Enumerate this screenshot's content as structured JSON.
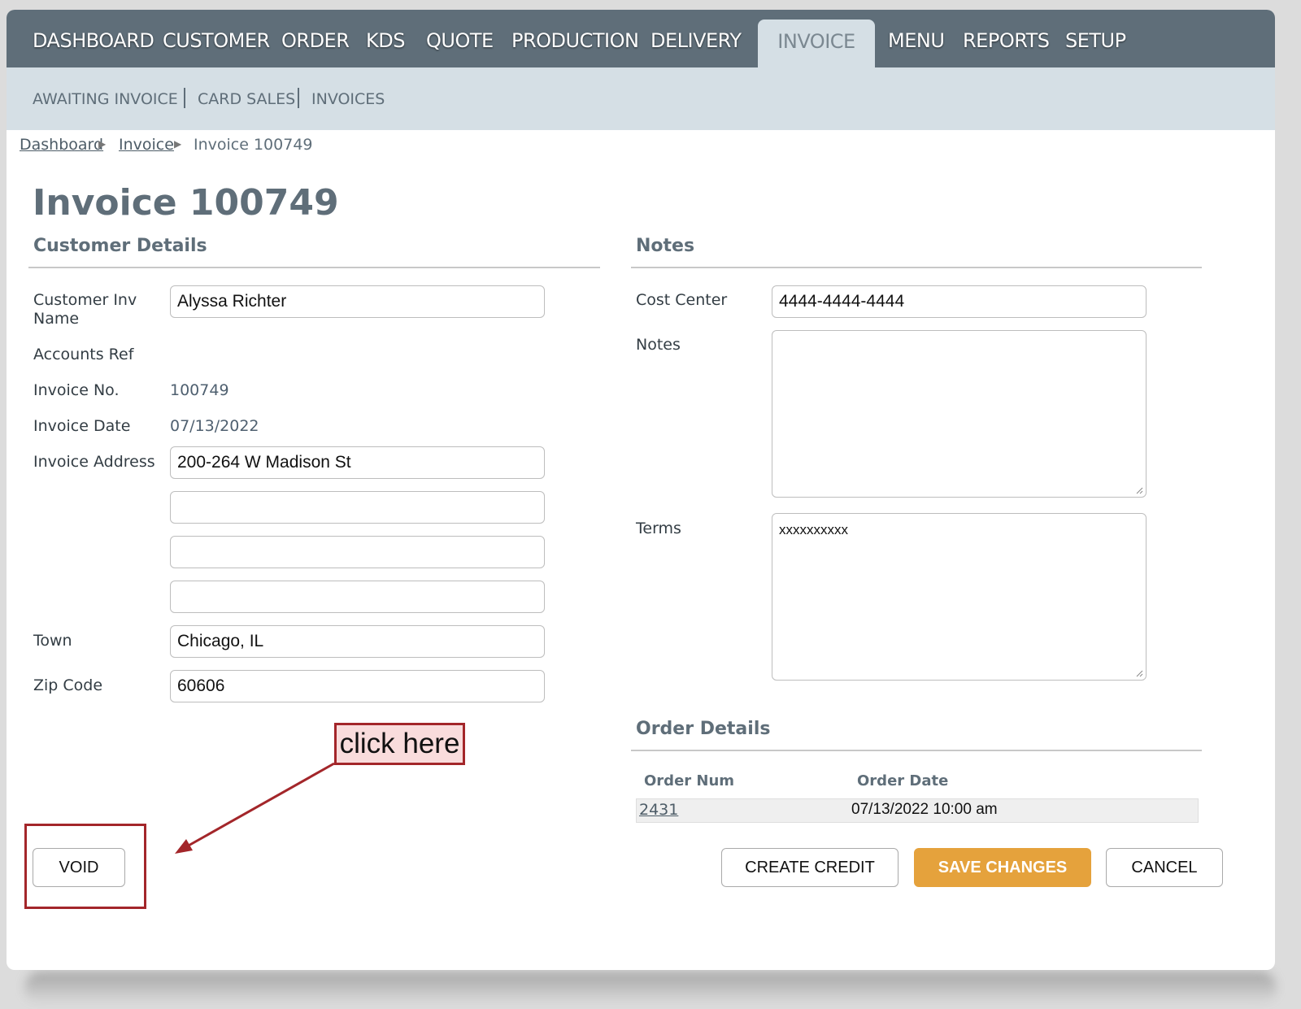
{
  "topnav": {
    "items": [
      "DASHBOARD",
      "CUSTOMER",
      "ORDER",
      "KDS",
      "QUOTE",
      "PRODUCTION",
      "DELIVERY",
      "INVOICE",
      "MENU",
      "REPORTS",
      "SETUP"
    ],
    "active": "INVOICE"
  },
  "subnav": {
    "items": [
      "AWAITING INVOICE",
      "CARD SALES",
      "INVOICES"
    ]
  },
  "breadcrumb": {
    "items": [
      "Dashboard",
      "Invoice",
      "Invoice 100749"
    ],
    "arrow": "▶"
  },
  "page": {
    "title": "Invoice 100749"
  },
  "customer": {
    "section_title": "Customer Details",
    "labels": {
      "name": "Customer Inv Name",
      "accounts_ref": "Accounts Ref",
      "invoice_no": "Invoice No.",
      "invoice_date": "Invoice Date",
      "invoice_address": "Invoice Address",
      "town": "Town",
      "zip": "Zip Code"
    },
    "name_value": "Alyssa Richter",
    "accounts_ref_value": "",
    "invoice_no_value": "100749",
    "invoice_date_value": "07/13/2022",
    "address_lines": [
      "200-264 W Madison St",
      "",
      "",
      ""
    ],
    "town_value": "Chicago, IL",
    "zip_value": "60606"
  },
  "notes": {
    "section_title": "Notes",
    "labels": {
      "cost_center": "Cost Center",
      "notes": "Notes",
      "terms": "Terms"
    },
    "cost_center_value": "4444-4444-4444",
    "notes_value": "",
    "terms_value": "xxxxxxxxxx"
  },
  "order_details": {
    "section_title": "Order Details",
    "columns": [
      "Order Num",
      "Order Date"
    ],
    "rows": [
      {
        "order_num": "2431",
        "order_date": "07/13/2022 10:00 am"
      }
    ]
  },
  "buttons": {
    "void": "VOID",
    "create_credit": "CREATE CREDIT",
    "save_changes": "SAVE CHANGES",
    "cancel": "CANCEL"
  },
  "annotation": {
    "callout_text": "click here",
    "color": "#a3262a"
  },
  "colors": {
    "nav_bg": "#5f6e79",
    "subnav_bg": "#d5dfe5",
    "primary_button": "#e5a23c"
  }
}
